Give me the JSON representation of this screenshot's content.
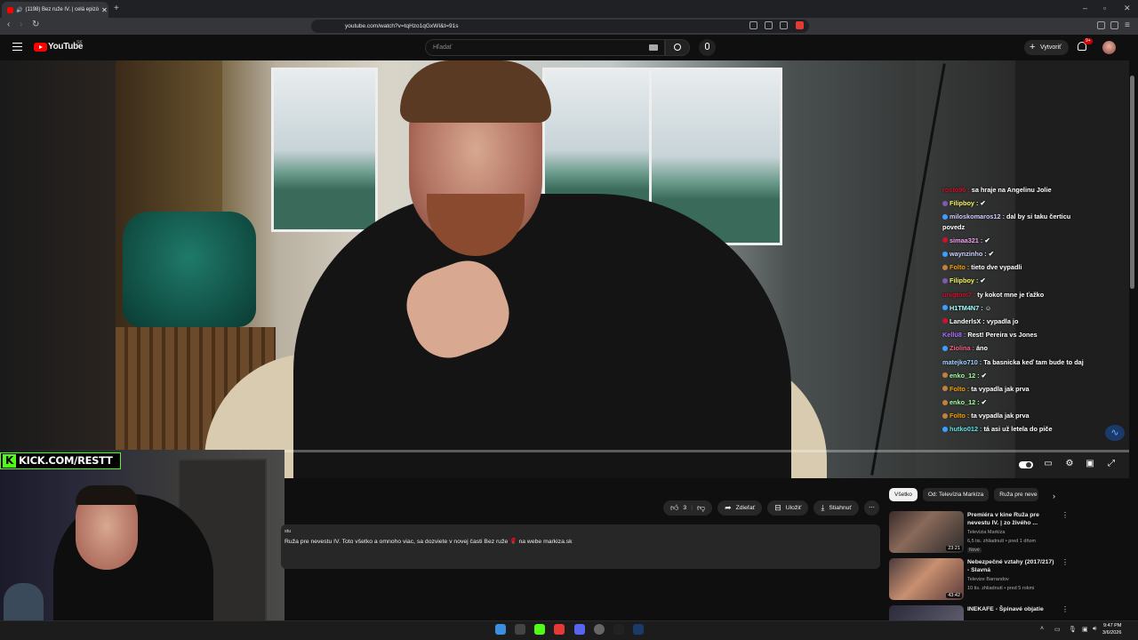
{
  "browser": {
    "tab_title": "(1198) Bez ruže IV. | celá epizó",
    "url": "youtube.com/watch?v=tqHzo1qGxWI&t=91s"
  },
  "youtube": {
    "logo_text": "YouTube",
    "country": "SK",
    "search_placeholder": "Hľadať",
    "create_label": "Vytvoriť",
    "notif_badge": "9+"
  },
  "video": {
    "progress": 0.018
  },
  "chat": [
    {
      "user": "rosto96",
      "color": "#d0102c",
      "dot": "",
      "text": "sa hraje na Angelinu Jolie"
    },
    {
      "user": "Filipboy",
      "color": "#f7f75a",
      "dot": "#7d5ab0",
      "text": "✔"
    },
    {
      "user": "miloskomaros12",
      "color": "#d0d0ff",
      "dot": "#3aa0ff",
      "text": "dal by si taku čerticu povedz"
    },
    {
      "user": "simaa321",
      "color": "#f0a0f0",
      "dot": "#d0102c",
      "text": "✔"
    },
    {
      "user": "waynzinho",
      "color": "#d0d0ff",
      "dot": "#3aa0ff",
      "text": "✔"
    },
    {
      "user": "Folto",
      "color": "#f7a000",
      "dot": "#c08040",
      "text": "tieto dve vypadli"
    },
    {
      "user": "Filipboy",
      "color": "#f7f75a",
      "dot": "#7d5ab0",
      "text": "✔"
    },
    {
      "user": "unigtom7",
      "color": "#d0102c",
      "dot": "",
      "text": "ty kokot mne je ťažko"
    },
    {
      "user": "H1TM4N7",
      "color": "#a0ffff",
      "dot": "#3aa0ff",
      "text": "☺"
    },
    {
      "user": "LanderlsX",
      "color": "#ffffff",
      "dot": "#d0102c",
      "text": "vypadla jo"
    },
    {
      "user": "Kellü8",
      "color": "#b070ff",
      "dot": "",
      "text": "Rest! Pereira vs Jones"
    },
    {
      "user": "Ziolina",
      "color": "#f06080",
      "dot": "#3aa0ff",
      "text": "áno"
    },
    {
      "user": "matejko710",
      "color": "#a0d0ff",
      "dot": "",
      "text": "Ta basnicka keď tam bude to daj"
    },
    {
      "user": "enko_12",
      "color": "#a0ffa0",
      "dot": "#c08040",
      "text": "✔"
    },
    {
      "user": "Folto",
      "color": "#f7a000",
      "dot": "#c08040",
      "text": "ta vypadla jak prva"
    },
    {
      "user": "enko_12",
      "color": "#a0ffa0",
      "dot": "#c08040",
      "text": "✔"
    },
    {
      "user": "Folto",
      "color": "#f7a000",
      "dot": "#c08040",
      "text": "ta vypadla jak prva"
    },
    {
      "user": "hutko012",
      "color": "#60e0e0",
      "dot": "#3aa0ff",
      "text": "tá asi už letela do piče"
    }
  ],
  "stream": {
    "kick_text": "KICK.COM/RESTT"
  },
  "actions": {
    "like_count": "3",
    "share_label": "Zdieľať",
    "save_label": "Uložiť",
    "download_label": "Stiahnuť"
  },
  "description": {
    "meta": "stu",
    "text": "Ruža pre nevestu IV. Toto všetko a omnoho viac, sa dozviete v novej časti Bez ruže 🌹 na webe markiza.sk"
  },
  "chips": [
    "Všetko",
    "Od: Televízia Markíza",
    "Ruža pre neve"
  ],
  "recommendations": [
    {
      "title": "Premiéra v kine Ruža pre nevestu IV. | zo živého ...",
      "channel": "Televízia Markíza",
      "meta": "6,5 tis. zhliadnutí • pred 1 dňom",
      "badge": "Nové",
      "duration": "23:21"
    },
    {
      "title": "Nebezpečné vztahy (2017/217) - Slavná",
      "channel": "Televize Barrandov",
      "meta": "10 tis. zhliadnutí • pred 5 rokmi",
      "badge": "",
      "duration": "43:42"
    },
    {
      "title": "INEKAFE - Špinavé objatie",
      "channel": "",
      "meta": "",
      "badge": "",
      "duration": ""
    }
  ],
  "taskbar": {
    "time": "9:47 PM",
    "date": "3/6/2026"
  }
}
